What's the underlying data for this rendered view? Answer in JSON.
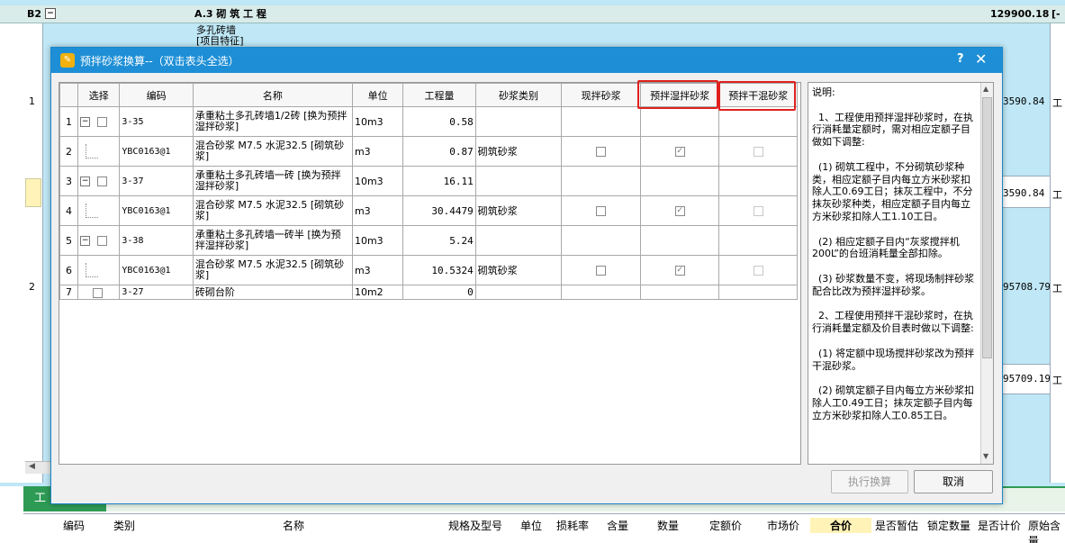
{
  "background": {
    "header_row_id": "B2",
    "header_title": "A.3  砌 筑 工 程",
    "header_total": "129900.18",
    "header_tail": "[-",
    "row_cell_text": "多孔砖墙\n[项目特征]",
    "row_numbers": [
      "1",
      "2"
    ],
    "right_values": [
      "3590.84",
      "3590.84",
      "95708.79",
      "95709.19"
    ],
    "right_tail": [
      "工",
      "工",
      "工",
      "工"
    ],
    "tab_label": "工",
    "footer_headers": [
      "编码",
      "类别",
      "名称",
      "规格及型号",
      "单位",
      "损耗率",
      "含量",
      "数量",
      "定额价",
      "市场价",
      "合价",
      "是否暂估",
      "锁定数量",
      "是否计价",
      "原始含量"
    ]
  },
  "dialog": {
    "title": "预拌砂浆换算--（双击表头全选）",
    "help_label": "?",
    "close_label": "✕",
    "columns": [
      "",
      "选择",
      "编码",
      "名称",
      "单位",
      "工程量",
      "砂浆类别",
      "现拌砂浆",
      "预拌湿拌砂浆",
      "预拌干混砂浆"
    ],
    "rows": [
      {
        "idx": "1",
        "code": "3-35",
        "name": "承重粘土多孔砖墙1/2砖  [换为预拌湿拌砂浆]",
        "unit": "10m3",
        "qty": "0.58",
        "type": "",
        "parent": true,
        "checks": [
          "",
          "",
          ""
        ]
      },
      {
        "idx": "2",
        "code": "YBC0163@1",
        "name": "混合砂浆 M7.5 水泥32.5  [砌筑砂浆]",
        "unit": "m3",
        "qty": "0.87",
        "type": "砌筑砂浆",
        "parent": false,
        "checks": [
          "off",
          "on",
          "dis"
        ]
      },
      {
        "idx": "3",
        "code": "3-37",
        "name": "承重粘土多孔砖墙一砖  [换为预拌湿拌砂浆]",
        "unit": "10m3",
        "qty": "16.11",
        "type": "",
        "parent": true,
        "checks": [
          "",
          "",
          ""
        ]
      },
      {
        "idx": "4",
        "code": "YBC0163@1",
        "name": "混合砂浆 M7.5 水泥32.5  [砌筑砂浆]",
        "unit": "m3",
        "qty": "30.4479",
        "type": "砌筑砂浆",
        "parent": false,
        "checks": [
          "off",
          "on",
          "dis"
        ]
      },
      {
        "idx": "5",
        "code": "3-38",
        "name": "承重粘土多孔砖墙一砖半  [换为预拌湿拌砂浆]",
        "unit": "10m3",
        "qty": "5.24",
        "type": "",
        "parent": true,
        "checks": [
          "",
          "",
          ""
        ]
      },
      {
        "idx": "6",
        "code": "YBC0163@1",
        "name": "混合砂浆 M7.5 水泥32.5  [砌筑砂浆]",
        "unit": "m3",
        "qty": "10.5324",
        "type": "砌筑砂浆",
        "parent": false,
        "checks": [
          "off",
          "on",
          "dis"
        ]
      },
      {
        "idx": "7",
        "code": "3-27",
        "name": "砖砌台阶",
        "unit": "10m2",
        "qty": "0",
        "type": "",
        "parent": false,
        "single": true,
        "checks": [
          "",
          "",
          ""
        ]
      }
    ],
    "description": "说明:\n\n  1、工程使用预拌湿拌砂浆时，在执行消耗量定额时，需对相应定额子目做如下调整:\n\n  (1) 砌筑工程中，不分砌筑砂浆种类，相应定额子目内每立方米砂浆扣除人工0.69工日；抹灰工程中，不分抹灰砂浆种类，相应定额子目内每立方米砂浆扣除人工1.10工日。\n\n  (2) 相应定额子目内“灰浆搅拌机200L”的台班消耗量全部扣除。\n\n  (3) 砂浆数量不变，将现场制拌砂浆配合比改为预拌湿拌砂浆。\n\n  2、工程使用预拌干混砂浆时，在执行消耗量定额及价目表时做以下调整:\n\n  (1) 将定额中现场搅拌砂浆改为预拌干混砂浆。\n\n  (2) 砌筑定额子目内每立方米砂浆扣除人工0.49工日；抹灰定额子目内每立方米砂浆扣除人工0.85工日。",
    "execute_label": "执行换算",
    "cancel_label": "取消"
  },
  "colors": {
    "title_bar": "#1e8fd6",
    "highlight": "#e0211e",
    "tab": "#2e9b55"
  }
}
